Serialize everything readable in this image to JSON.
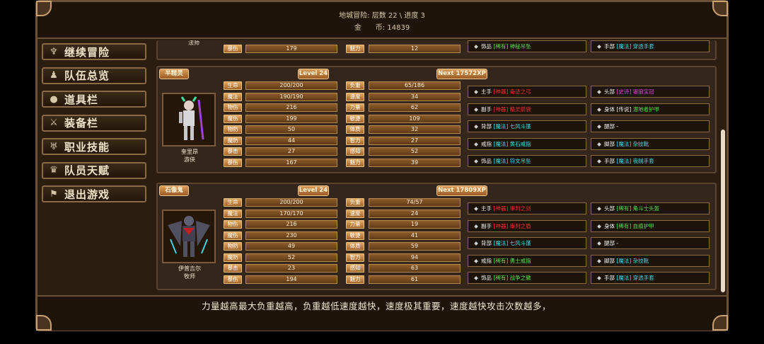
{
  "header": {
    "line1": "地城冒险: 层数 22 \\ 进度 3",
    "gold_label": "金　　币:",
    "gold": "14839"
  },
  "menu": [
    {
      "label": "继续冒险",
      "icon": "demon-icon"
    },
    {
      "label": "队伍总览",
      "icon": "party-icon"
    },
    {
      "label": "道具栏",
      "icon": "bag-icon"
    },
    {
      "label": "装备栏",
      "icon": "equipment-icon"
    },
    {
      "label": "职业技能",
      "icon": "wings-icon"
    },
    {
      "label": "队员天赋",
      "icon": "laurel-icon"
    },
    {
      "label": "退出游戏",
      "icon": "flag-icon"
    }
  ],
  "partial": {
    "class": "法师",
    "left": {
      "l1": "暴伤",
      "v1": "179",
      "l2": "魅力",
      "v2": "12"
    },
    "slots": [
      {
        "slot": "饰品",
        "rarity": "[稀有]",
        "name": "神秘吊坠",
        "rc": "c-green",
        "nc": "c-green"
      },
      {
        "slot": "手部",
        "rarity": "[魔法]",
        "name": "穿透手套",
        "rc": "c-cyan",
        "nc": "c-cyan"
      }
    ]
  },
  "heroes": [
    {
      "race": "半精灵",
      "level": "Level 24",
      "next": "Next 17572XP",
      "name": "奎里昂",
      "class": "游侠",
      "stats": [
        [
          "生命",
          "200/200",
          "负重",
          "65/186"
        ],
        [
          "魔法",
          "190/190",
          "速度",
          "34"
        ],
        [
          "物伤",
          "216",
          "力量",
          "62"
        ],
        [
          "魔伤",
          "199",
          "敏捷",
          "109"
        ],
        [
          "物防",
          "50",
          "体质",
          "32"
        ],
        [
          "魔防",
          "44",
          "智力",
          "27"
        ],
        [
          "暴击",
          "27",
          "感知",
          "52"
        ],
        [
          "暴伤",
          "167",
          "魅力",
          "39"
        ]
      ],
      "slots": [
        {
          "slot": "主手",
          "rarity": "[神器]",
          "name": "奇迹之弓",
          "rc": "c-red",
          "nc": "c-red"
        },
        {
          "slot": "头部",
          "rarity": "[史诗]",
          "name": "银狼宝冠",
          "rc": "c-mag",
          "nc": "c-mag"
        },
        {
          "slot": "副手",
          "rarity": "[神器]",
          "name": "精灵箭袋",
          "rc": "c-red",
          "nc": "c-red"
        },
        {
          "slot": "身体",
          "rarity": "[传说]",
          "name": "潜地者护甲",
          "rc": "c-white",
          "nc": "c-green"
        },
        {
          "slot": "背部",
          "rarity": "[魔法]",
          "name": "七风斗篷",
          "rc": "c-cyan",
          "nc": "c-cyan"
        },
        {
          "slot": "腿部",
          "rarity": "",
          "name": "-",
          "rc": "c-white",
          "nc": "c-white"
        },
        {
          "slot": "戒指",
          "rarity": "[魔法]",
          "name": "黄石戒指",
          "rc": "c-cyan",
          "nc": "c-cyan"
        },
        {
          "slot": "脚部",
          "rarity": "[魔法]",
          "name": "杂技靴",
          "rc": "c-cyan",
          "nc": "c-cyan"
        },
        {
          "slot": "饰品",
          "rarity": "[魔法]",
          "name": "符文吊坠",
          "rc": "c-cyan",
          "nc": "c-cyan"
        },
        {
          "slot": "手部",
          "rarity": "[魔法]",
          "name": "夜贼手套",
          "rc": "c-cyan",
          "nc": "c-cyan"
        }
      ]
    },
    {
      "race": "石像鬼",
      "level": "Level 24",
      "next": "Next 17809XP",
      "name": "伊普吉尔",
      "class": "牧师",
      "stats": [
        [
          "生命",
          "200/200",
          "负重",
          "74/57"
        ],
        [
          "魔法",
          "170/170",
          "速度",
          "24"
        ],
        [
          "物伤",
          "216",
          "力量",
          "19"
        ],
        [
          "魔伤",
          "230",
          "敏捷",
          "41"
        ],
        [
          "物防",
          "49",
          "体质",
          "59"
        ],
        [
          "魔防",
          "52",
          "智力",
          "94"
        ],
        [
          "暴击",
          "23",
          "感知",
          "63"
        ],
        [
          "暴伤",
          "194",
          "魅力",
          "61"
        ]
      ],
      "slots": [
        {
          "slot": "主手",
          "rarity": "[神器]",
          "name": "审判之剑",
          "rc": "c-red",
          "nc": "c-red"
        },
        {
          "slot": "头部",
          "rarity": "[稀有]",
          "name": "角斗士头盔",
          "rc": "c-green",
          "nc": "c-green"
        },
        {
          "slot": "副手",
          "rarity": "[神器]",
          "name": "审判之盾",
          "rc": "c-red",
          "nc": "c-red"
        },
        {
          "slot": "身体",
          "rarity": "[稀有]",
          "name": "血痕护甲",
          "rc": "c-green",
          "nc": "c-green"
        },
        {
          "slot": "背部",
          "rarity": "[魔法]",
          "name": "七风斗篷",
          "rc": "c-cyan",
          "nc": "c-cyan"
        },
        {
          "slot": "腿部",
          "rarity": "",
          "name": "-",
          "rc": "c-white",
          "nc": "c-white"
        },
        {
          "slot": "戒指",
          "rarity": "[稀有]",
          "name": "勇士戒指",
          "rc": "c-green",
          "nc": "c-green"
        },
        {
          "slot": "脚部",
          "rarity": "[魔法]",
          "name": "杂技靴",
          "rc": "c-cyan",
          "nc": "c-cyan"
        },
        {
          "slot": "饰品",
          "rarity": "[稀有]",
          "name": "战争之徽",
          "rc": "c-green",
          "nc": "c-green"
        },
        {
          "slot": "手部",
          "rarity": "[魔法]",
          "name": "穿透手套",
          "rc": "c-cyan",
          "nc": "c-cyan"
        }
      ]
    }
  ],
  "message": "力量越高最大负重越高，负重越低速度越快，速度极其重要，速度越快攻击次数越多，"
}
